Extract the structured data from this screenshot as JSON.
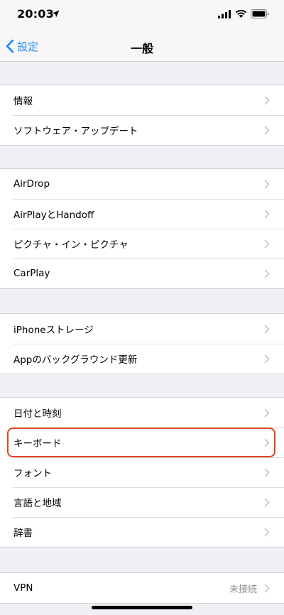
{
  "status_bar": {
    "time": "20:03",
    "icons": [
      "location-arrow-icon",
      "signal-icon",
      "wifi-icon",
      "battery-icon"
    ]
  },
  "nav": {
    "back_label": "設定",
    "title": "一般"
  },
  "groups": [
    {
      "rows": [
        {
          "label": "情報"
        },
        {
          "label": "ソフトウェア・アップデート"
        }
      ]
    },
    {
      "rows": [
        {
          "label": "AirDrop"
        },
        {
          "label": "AirPlayとHandoff"
        },
        {
          "label": "ピクチャ・イン・ピクチャ"
        },
        {
          "label": "CarPlay"
        }
      ]
    },
    {
      "rows": [
        {
          "label": "iPhoneストレージ"
        },
        {
          "label": "Appのバックグラウンド更新"
        }
      ]
    },
    {
      "rows": [
        {
          "label": "日付と時刻"
        },
        {
          "label": "キーボード"
        },
        {
          "label": "フォント"
        },
        {
          "label": "言語と地域"
        },
        {
          "label": "辞書"
        }
      ]
    },
    {
      "rows": [
        {
          "label": "VPN",
          "value": "未接続"
        }
      ]
    }
  ],
  "colors": {
    "accent": "#1a82fb",
    "highlight": "#e0451f",
    "background": "#efeff4"
  }
}
